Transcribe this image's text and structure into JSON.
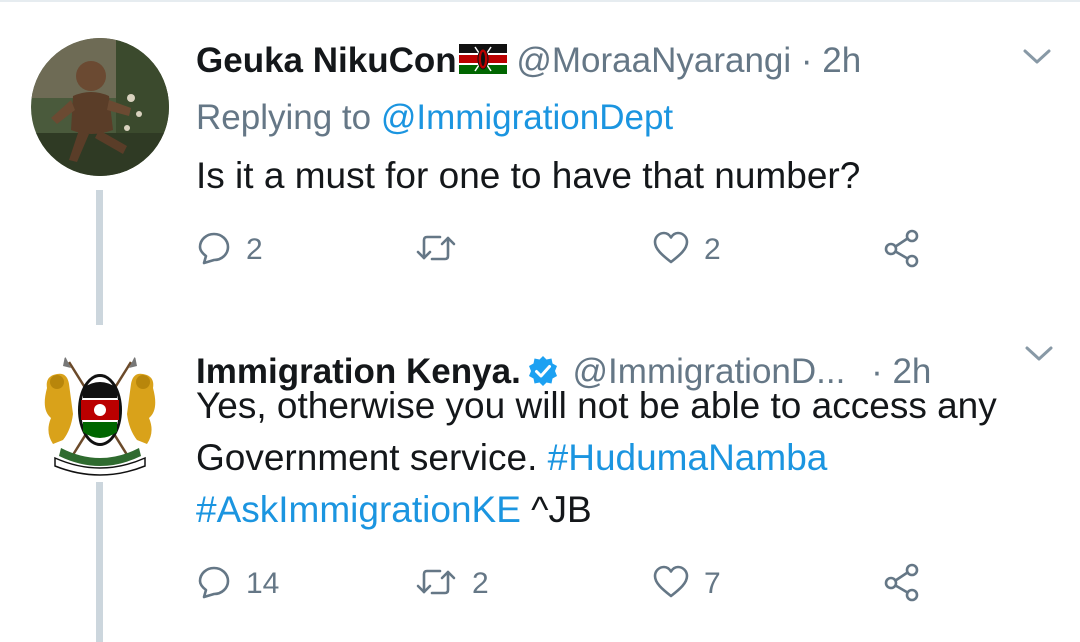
{
  "colors": {
    "link": "#1b95e0",
    "secondary_text": "#657786",
    "primary_text": "#14171a",
    "verified": "#1da1f2",
    "thread_line": "#ccd6dd"
  },
  "tweets": [
    {
      "name": "Geuka NikuCon",
      "name_emoji": "kenya-flag",
      "handle": "@MoraaNyarangi",
      "separator": "·",
      "time": "2h",
      "replying_label": "Replying to",
      "replying_handle": "@ImmigrationDept",
      "text": "Is it a must for one to have that number?",
      "reply_count": "2",
      "retweet_count": "",
      "like_count": "2",
      "icons": [
        "reply-icon",
        "retweet-icon",
        "like-icon",
        "share-icon",
        "chevron-down-icon"
      ]
    },
    {
      "name": "Immigration Kenya.",
      "verified": true,
      "handle": "@ImmigrationD...",
      "separator": "·",
      "time": "2h",
      "text_plain": "Yes, otherwise you will not be able to access any Government service.",
      "hashtag1": "#HudumaNamba",
      "hashtag2": "#AskImmigrationKE",
      "signature": "^JB",
      "reply_count": "14",
      "retweet_count": "2",
      "like_count": "7",
      "icons": [
        "verified-icon",
        "reply-icon",
        "retweet-icon",
        "like-icon",
        "share-icon",
        "chevron-down-icon"
      ]
    }
  ]
}
